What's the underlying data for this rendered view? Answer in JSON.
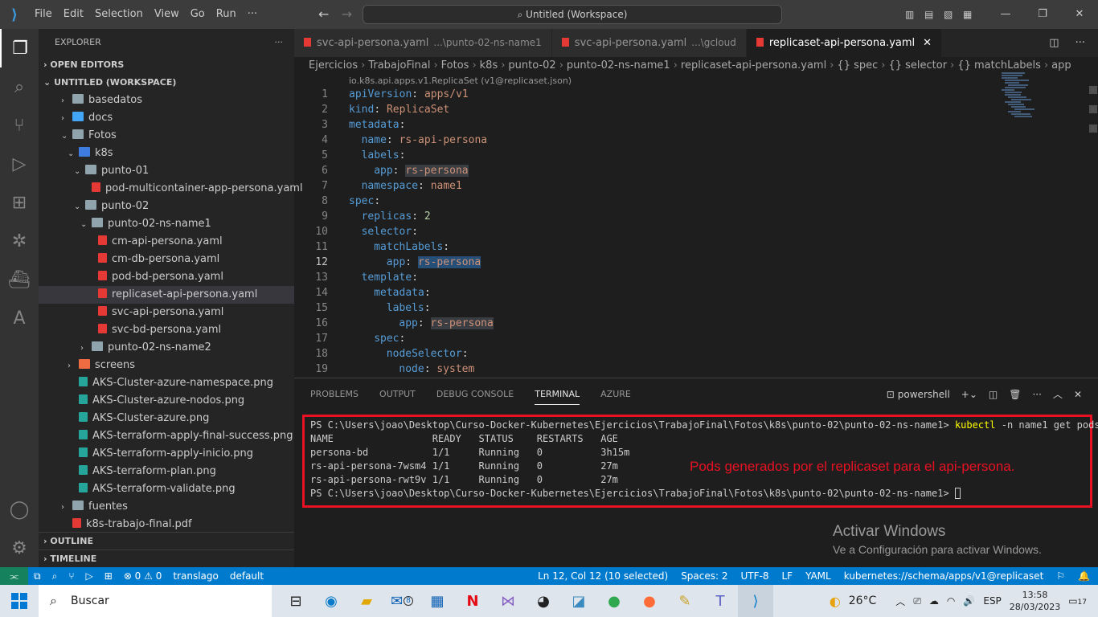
{
  "titlebar": {
    "menu": [
      "File",
      "Edit",
      "Selection",
      "View",
      "Go",
      "Run",
      "···"
    ],
    "search": "Untitled (Workspace)"
  },
  "sidebar": {
    "title": "EXPLORER",
    "open_editors": "OPEN EDITORS",
    "workspace": "UNTITLED (WORKSPACE)",
    "tree": [
      {
        "label": "basedatos",
        "depth": 1,
        "chev": "›",
        "icon": "folder"
      },
      {
        "label": "docs",
        "depth": 1,
        "chev": "›",
        "icon": "folder-blue"
      },
      {
        "label": "Fotos",
        "depth": 1,
        "chev": "⌄",
        "icon": "folder"
      },
      {
        "label": "k8s",
        "depth": 2,
        "chev": "⌄",
        "icon": "folder-k8s"
      },
      {
        "label": "punto-01",
        "depth": 3,
        "chev": "⌄",
        "icon": "folder"
      },
      {
        "label": "pod-multicontainer-app-persona.yaml",
        "depth": 4,
        "chev": "",
        "icon": "yaml"
      },
      {
        "label": "punto-02",
        "depth": 3,
        "chev": "⌄",
        "icon": "folder"
      },
      {
        "label": "punto-02-ns-name1",
        "depth": 4,
        "chev": "⌄",
        "icon": "folder"
      },
      {
        "label": "cm-api-persona.yaml",
        "depth": 5,
        "chev": "",
        "icon": "yaml"
      },
      {
        "label": "cm-db-persona.yaml",
        "depth": 5,
        "chev": "",
        "icon": "yaml"
      },
      {
        "label": "pod-bd-persona.yaml",
        "depth": 5,
        "chev": "",
        "icon": "yaml"
      },
      {
        "label": "replicaset-api-persona.yaml",
        "depth": 5,
        "chev": "",
        "icon": "yaml",
        "selected": true
      },
      {
        "label": "svc-api-persona.yaml",
        "depth": 5,
        "chev": "",
        "icon": "yaml"
      },
      {
        "label": "svc-bd-persona.yaml",
        "depth": 5,
        "chev": "",
        "icon": "yaml"
      },
      {
        "label": "punto-02-ns-name2",
        "depth": 4,
        "chev": "›",
        "icon": "folder"
      },
      {
        "label": "screens",
        "depth": 2,
        "chev": "›",
        "icon": "folder-red"
      },
      {
        "label": "AKS-Cluster-azure-namespace.png",
        "depth": 2,
        "chev": "",
        "icon": "png"
      },
      {
        "label": "AKS-Cluster-azure-nodos.png",
        "depth": 2,
        "chev": "",
        "icon": "png"
      },
      {
        "label": "AKS-Cluster-azure.png",
        "depth": 2,
        "chev": "",
        "icon": "png"
      },
      {
        "label": "AKS-terraform-apply-final-success.png",
        "depth": 2,
        "chev": "",
        "icon": "png"
      },
      {
        "label": "AKS-terraform-apply-inicio.png",
        "depth": 2,
        "chev": "",
        "icon": "png"
      },
      {
        "label": "AKS-terraform-plan.png",
        "depth": 2,
        "chev": "",
        "icon": "png"
      },
      {
        "label": "AKS-terraform-validate.png",
        "depth": 2,
        "chev": "",
        "icon": "png"
      },
      {
        "label": "fuentes",
        "depth": 1,
        "chev": "›",
        "icon": "folder"
      },
      {
        "label": "k8s-trabajo-final.pdf",
        "depth": 1,
        "chev": "",
        "icon": "pdf"
      }
    ],
    "outline": "OUTLINE",
    "timeline": "TIMELINE"
  },
  "tabs": [
    {
      "name": "svc-api-persona.yaml",
      "path": "...\\punto-02-ns-name1",
      "active": false
    },
    {
      "name": "svc-api-persona.yaml",
      "path": "...\\gcloud",
      "active": false
    },
    {
      "name": "replicaset-api-persona.yaml",
      "path": "",
      "active": true
    }
  ],
  "breadcrumb": [
    "Ejercicios",
    "TrabajoFinal",
    "Fotos",
    "k8s",
    "punto-02",
    "punto-02-ns-name1",
    "replicaset-api-persona.yaml",
    "{} spec",
    "{} selector",
    "{} matchLabels",
    "app"
  ],
  "schema_hint": "io.k8s.api.apps.v1.ReplicaSet (v1@replicaset.json)",
  "editor": {
    "lines": [
      {
        "n": "1",
        "indent": 0,
        "key": "apiVersion",
        "val": "apps/v1"
      },
      {
        "n": "2",
        "indent": 0,
        "key": "kind",
        "val": "ReplicaSet"
      },
      {
        "n": "3",
        "indent": 0,
        "key": "metadata",
        "val": ""
      },
      {
        "n": "4",
        "indent": 1,
        "key": "name",
        "val": "rs-api-persona"
      },
      {
        "n": "5",
        "indent": 1,
        "key": "labels",
        "val": ""
      },
      {
        "n": "6",
        "indent": 2,
        "key": "app",
        "val": "rs-persona",
        "hl": true
      },
      {
        "n": "7",
        "indent": 1,
        "key": "namespace",
        "val": "name1"
      },
      {
        "n": "8",
        "indent": 0,
        "key": "spec",
        "val": ""
      },
      {
        "n": "9",
        "indent": 1,
        "key": "replicas",
        "val": "2",
        "num": true
      },
      {
        "n": "10",
        "indent": 1,
        "key": "selector",
        "val": ""
      },
      {
        "n": "11",
        "indent": 2,
        "key": "matchLabels",
        "val": ""
      },
      {
        "n": "12",
        "indent": 3,
        "key": "app",
        "val": "rs-persona",
        "sel": true,
        "cur": true
      },
      {
        "n": "13",
        "indent": 1,
        "key": "template",
        "val": ""
      },
      {
        "n": "14",
        "indent": 2,
        "key": "metadata",
        "val": ""
      },
      {
        "n": "15",
        "indent": 3,
        "key": "labels",
        "val": ""
      },
      {
        "n": "16",
        "indent": 4,
        "key": "app",
        "val": "rs-persona",
        "hl": true
      },
      {
        "n": "17",
        "indent": 2,
        "key": "spec",
        "val": ""
      },
      {
        "n": "18",
        "indent": 3,
        "key": "nodeSelector",
        "val": ""
      },
      {
        "n": "19",
        "indent": 4,
        "key": "node",
        "val": "system"
      }
    ]
  },
  "panel": {
    "tabs": [
      "PROBLEMS",
      "OUTPUT",
      "DEBUG CONSOLE",
      "TERMINAL",
      "AZURE"
    ],
    "active_tab": "TERMINAL",
    "shell": "powershell",
    "prompt": "PS C:\\Users\\joao\\Desktop\\Curso-Docker-Kubernetes\\Ejercicios\\TrabajoFinal\\Fotos\\k8s\\punto-02\\punto-02-ns-name1>",
    "command": "kubectl",
    "command_args": " -n name1 get pods",
    "header": "NAME                 READY   STATUS    RESTARTS   AGE",
    "rows": [
      "persona-bd           1/1     Running   0          3h15m",
      "rs-api-persona-7wsm4 1/1     Running   0          27m",
      "rs-api-persona-rwt9v 1/1     Running   0          27m"
    ],
    "annotation": "Pods generados por el replicaset para el api-persona.",
    "activate_title": "Activar Windows",
    "activate_sub": "Ve a Configuración para activar Windows."
  },
  "statusbar": {
    "errors": "⊗ 0 ⚠ 0",
    "branch": "translago",
    "profile": "default",
    "position": "Ln 12, Col 12 (10 selected)",
    "spaces": "Spaces: 2",
    "encoding": "UTF-8",
    "eol": "LF",
    "language": "YAML",
    "schema": "kubernetes://schema/apps/v1@replicaset"
  },
  "taskbar": {
    "search": "Buscar",
    "mail_badge": "8",
    "weather": "26°C",
    "lang": "ESP",
    "time": "13:58",
    "date": "28/03/2023",
    "notif": "17"
  },
  "colors": {
    "accent": "#007acc",
    "annotation": "#e81123",
    "command": "#ffff00"
  }
}
